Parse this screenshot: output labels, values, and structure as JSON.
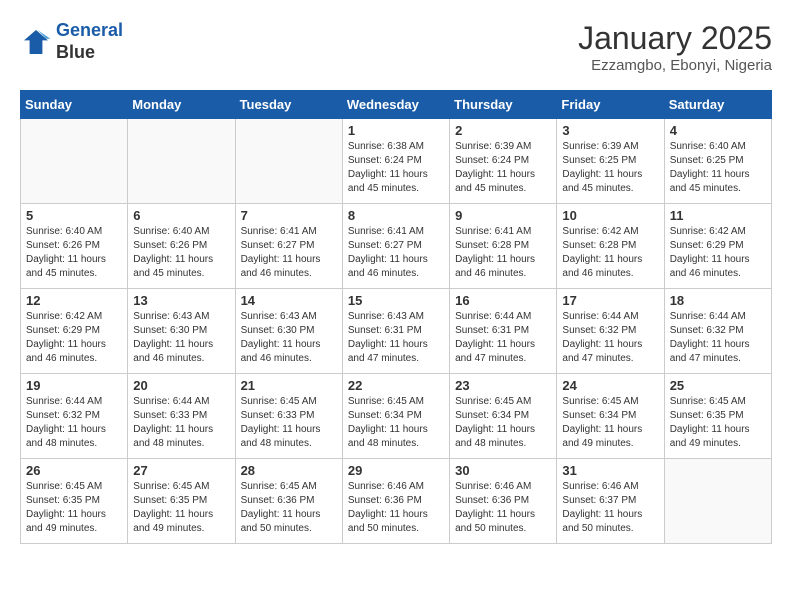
{
  "header": {
    "logo_line1": "General",
    "logo_line2": "Blue",
    "title": "January 2025",
    "subtitle": "Ezzamgbo, Ebonyi, Nigeria"
  },
  "weekdays": [
    "Sunday",
    "Monday",
    "Tuesday",
    "Wednesday",
    "Thursday",
    "Friday",
    "Saturday"
  ],
  "weeks": [
    [
      {
        "day": "",
        "info": ""
      },
      {
        "day": "",
        "info": ""
      },
      {
        "day": "",
        "info": ""
      },
      {
        "day": "1",
        "info": "Sunrise: 6:38 AM\nSunset: 6:24 PM\nDaylight: 11 hours\nand 45 minutes."
      },
      {
        "day": "2",
        "info": "Sunrise: 6:39 AM\nSunset: 6:24 PM\nDaylight: 11 hours\nand 45 minutes."
      },
      {
        "day": "3",
        "info": "Sunrise: 6:39 AM\nSunset: 6:25 PM\nDaylight: 11 hours\nand 45 minutes."
      },
      {
        "day": "4",
        "info": "Sunrise: 6:40 AM\nSunset: 6:25 PM\nDaylight: 11 hours\nand 45 minutes."
      }
    ],
    [
      {
        "day": "5",
        "info": "Sunrise: 6:40 AM\nSunset: 6:26 PM\nDaylight: 11 hours\nand 45 minutes."
      },
      {
        "day": "6",
        "info": "Sunrise: 6:40 AM\nSunset: 6:26 PM\nDaylight: 11 hours\nand 45 minutes."
      },
      {
        "day": "7",
        "info": "Sunrise: 6:41 AM\nSunset: 6:27 PM\nDaylight: 11 hours\nand 46 minutes."
      },
      {
        "day": "8",
        "info": "Sunrise: 6:41 AM\nSunset: 6:27 PM\nDaylight: 11 hours\nand 46 minutes."
      },
      {
        "day": "9",
        "info": "Sunrise: 6:41 AM\nSunset: 6:28 PM\nDaylight: 11 hours\nand 46 minutes."
      },
      {
        "day": "10",
        "info": "Sunrise: 6:42 AM\nSunset: 6:28 PM\nDaylight: 11 hours\nand 46 minutes."
      },
      {
        "day": "11",
        "info": "Sunrise: 6:42 AM\nSunset: 6:29 PM\nDaylight: 11 hours\nand 46 minutes."
      }
    ],
    [
      {
        "day": "12",
        "info": "Sunrise: 6:42 AM\nSunset: 6:29 PM\nDaylight: 11 hours\nand 46 minutes."
      },
      {
        "day": "13",
        "info": "Sunrise: 6:43 AM\nSunset: 6:30 PM\nDaylight: 11 hours\nand 46 minutes."
      },
      {
        "day": "14",
        "info": "Sunrise: 6:43 AM\nSunset: 6:30 PM\nDaylight: 11 hours\nand 46 minutes."
      },
      {
        "day": "15",
        "info": "Sunrise: 6:43 AM\nSunset: 6:31 PM\nDaylight: 11 hours\nand 47 minutes."
      },
      {
        "day": "16",
        "info": "Sunrise: 6:44 AM\nSunset: 6:31 PM\nDaylight: 11 hours\nand 47 minutes."
      },
      {
        "day": "17",
        "info": "Sunrise: 6:44 AM\nSunset: 6:32 PM\nDaylight: 11 hours\nand 47 minutes."
      },
      {
        "day": "18",
        "info": "Sunrise: 6:44 AM\nSunset: 6:32 PM\nDaylight: 11 hours\nand 47 minutes."
      }
    ],
    [
      {
        "day": "19",
        "info": "Sunrise: 6:44 AM\nSunset: 6:32 PM\nDaylight: 11 hours\nand 48 minutes."
      },
      {
        "day": "20",
        "info": "Sunrise: 6:44 AM\nSunset: 6:33 PM\nDaylight: 11 hours\nand 48 minutes."
      },
      {
        "day": "21",
        "info": "Sunrise: 6:45 AM\nSunset: 6:33 PM\nDaylight: 11 hours\nand 48 minutes."
      },
      {
        "day": "22",
        "info": "Sunrise: 6:45 AM\nSunset: 6:34 PM\nDaylight: 11 hours\nand 48 minutes."
      },
      {
        "day": "23",
        "info": "Sunrise: 6:45 AM\nSunset: 6:34 PM\nDaylight: 11 hours\nand 48 minutes."
      },
      {
        "day": "24",
        "info": "Sunrise: 6:45 AM\nSunset: 6:34 PM\nDaylight: 11 hours\nand 49 minutes."
      },
      {
        "day": "25",
        "info": "Sunrise: 6:45 AM\nSunset: 6:35 PM\nDaylight: 11 hours\nand 49 minutes."
      }
    ],
    [
      {
        "day": "26",
        "info": "Sunrise: 6:45 AM\nSunset: 6:35 PM\nDaylight: 11 hours\nand 49 minutes."
      },
      {
        "day": "27",
        "info": "Sunrise: 6:45 AM\nSunset: 6:35 PM\nDaylight: 11 hours\nand 49 minutes."
      },
      {
        "day": "28",
        "info": "Sunrise: 6:45 AM\nSunset: 6:36 PM\nDaylight: 11 hours\nand 50 minutes."
      },
      {
        "day": "29",
        "info": "Sunrise: 6:46 AM\nSunset: 6:36 PM\nDaylight: 11 hours\nand 50 minutes."
      },
      {
        "day": "30",
        "info": "Sunrise: 6:46 AM\nSunset: 6:36 PM\nDaylight: 11 hours\nand 50 minutes."
      },
      {
        "day": "31",
        "info": "Sunrise: 6:46 AM\nSunset: 6:37 PM\nDaylight: 11 hours\nand 50 minutes."
      },
      {
        "day": "",
        "info": ""
      }
    ]
  ]
}
